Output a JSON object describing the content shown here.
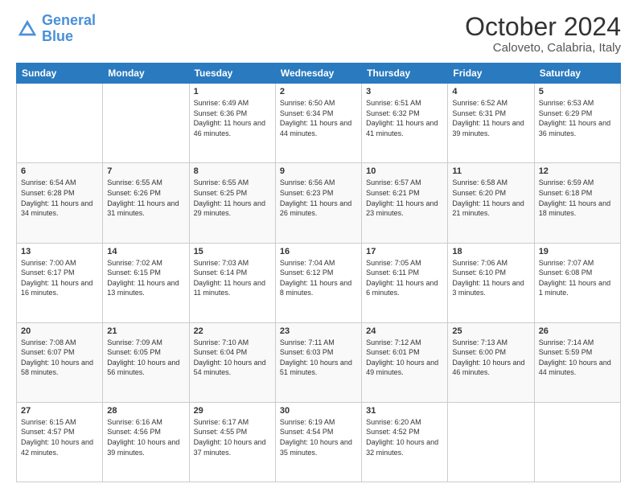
{
  "logo": {
    "line1": "General",
    "line2": "Blue"
  },
  "title": "October 2024",
  "subtitle": "Caloveto, Calabria, Italy",
  "days_header": [
    "Sunday",
    "Monday",
    "Tuesday",
    "Wednesday",
    "Thursday",
    "Friday",
    "Saturday"
  ],
  "weeks": [
    [
      null,
      null,
      {
        "num": "1",
        "sunrise": "6:49 AM",
        "sunset": "6:36 PM",
        "daylight": "11 hours and 46 minutes."
      },
      {
        "num": "2",
        "sunrise": "6:50 AM",
        "sunset": "6:34 PM",
        "daylight": "11 hours and 44 minutes."
      },
      {
        "num": "3",
        "sunrise": "6:51 AM",
        "sunset": "6:32 PM",
        "daylight": "11 hours and 41 minutes."
      },
      {
        "num": "4",
        "sunrise": "6:52 AM",
        "sunset": "6:31 PM",
        "daylight": "11 hours and 39 minutes."
      },
      {
        "num": "5",
        "sunrise": "6:53 AM",
        "sunset": "6:29 PM",
        "daylight": "11 hours and 36 minutes."
      }
    ],
    [
      {
        "num": "6",
        "sunrise": "6:54 AM",
        "sunset": "6:28 PM",
        "daylight": "11 hours and 34 minutes."
      },
      {
        "num": "7",
        "sunrise": "6:55 AM",
        "sunset": "6:26 PM",
        "daylight": "11 hours and 31 minutes."
      },
      {
        "num": "8",
        "sunrise": "6:55 AM",
        "sunset": "6:25 PM",
        "daylight": "11 hours and 29 minutes."
      },
      {
        "num": "9",
        "sunrise": "6:56 AM",
        "sunset": "6:23 PM",
        "daylight": "11 hours and 26 minutes."
      },
      {
        "num": "10",
        "sunrise": "6:57 AM",
        "sunset": "6:21 PM",
        "daylight": "11 hours and 23 minutes."
      },
      {
        "num": "11",
        "sunrise": "6:58 AM",
        "sunset": "6:20 PM",
        "daylight": "11 hours and 21 minutes."
      },
      {
        "num": "12",
        "sunrise": "6:59 AM",
        "sunset": "6:18 PM",
        "daylight": "11 hours and 18 minutes."
      }
    ],
    [
      {
        "num": "13",
        "sunrise": "7:00 AM",
        "sunset": "6:17 PM",
        "daylight": "11 hours and 16 minutes."
      },
      {
        "num": "14",
        "sunrise": "7:02 AM",
        "sunset": "6:15 PM",
        "daylight": "11 hours and 13 minutes."
      },
      {
        "num": "15",
        "sunrise": "7:03 AM",
        "sunset": "6:14 PM",
        "daylight": "11 hours and 11 minutes."
      },
      {
        "num": "16",
        "sunrise": "7:04 AM",
        "sunset": "6:12 PM",
        "daylight": "11 hours and 8 minutes."
      },
      {
        "num": "17",
        "sunrise": "7:05 AM",
        "sunset": "6:11 PM",
        "daylight": "11 hours and 6 minutes."
      },
      {
        "num": "18",
        "sunrise": "7:06 AM",
        "sunset": "6:10 PM",
        "daylight": "11 hours and 3 minutes."
      },
      {
        "num": "19",
        "sunrise": "7:07 AM",
        "sunset": "6:08 PM",
        "daylight": "11 hours and 1 minute."
      }
    ],
    [
      {
        "num": "20",
        "sunrise": "7:08 AM",
        "sunset": "6:07 PM",
        "daylight": "10 hours and 58 minutes."
      },
      {
        "num": "21",
        "sunrise": "7:09 AM",
        "sunset": "6:05 PM",
        "daylight": "10 hours and 56 minutes."
      },
      {
        "num": "22",
        "sunrise": "7:10 AM",
        "sunset": "6:04 PM",
        "daylight": "10 hours and 54 minutes."
      },
      {
        "num": "23",
        "sunrise": "7:11 AM",
        "sunset": "6:03 PM",
        "daylight": "10 hours and 51 minutes."
      },
      {
        "num": "24",
        "sunrise": "7:12 AM",
        "sunset": "6:01 PM",
        "daylight": "10 hours and 49 minutes."
      },
      {
        "num": "25",
        "sunrise": "7:13 AM",
        "sunset": "6:00 PM",
        "daylight": "10 hours and 46 minutes."
      },
      {
        "num": "26",
        "sunrise": "7:14 AM",
        "sunset": "5:59 PM",
        "daylight": "10 hours and 44 minutes."
      }
    ],
    [
      {
        "num": "27",
        "sunrise": "6:15 AM",
        "sunset": "4:57 PM",
        "daylight": "10 hours and 42 minutes."
      },
      {
        "num": "28",
        "sunrise": "6:16 AM",
        "sunset": "4:56 PM",
        "daylight": "10 hours and 39 minutes."
      },
      {
        "num": "29",
        "sunrise": "6:17 AM",
        "sunset": "4:55 PM",
        "daylight": "10 hours and 37 minutes."
      },
      {
        "num": "30",
        "sunrise": "6:19 AM",
        "sunset": "4:54 PM",
        "daylight": "10 hours and 35 minutes."
      },
      {
        "num": "31",
        "sunrise": "6:20 AM",
        "sunset": "4:52 PM",
        "daylight": "10 hours and 32 minutes."
      },
      null,
      null
    ]
  ]
}
